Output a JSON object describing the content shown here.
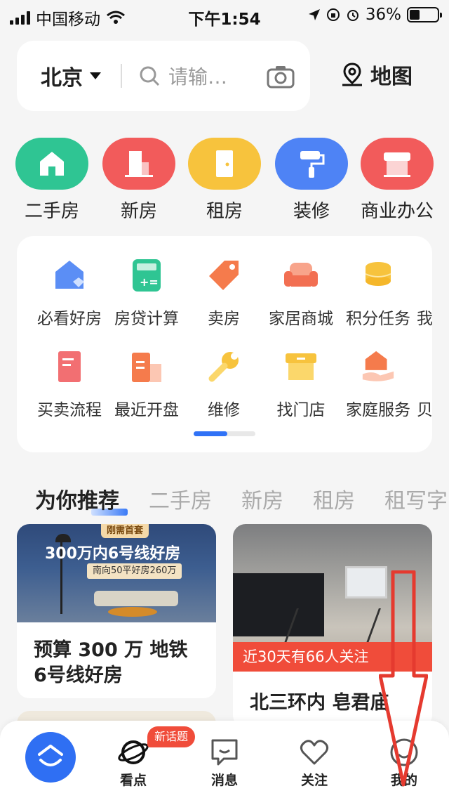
{
  "status_bar": {
    "carrier": "中国移动",
    "time": "下午1:54",
    "battery": "36%",
    "battery_level": 0.36
  },
  "header": {
    "city": "北京",
    "search_placeholder": "请输…",
    "map_label": "地图"
  },
  "categories": [
    {
      "label": "二手房",
      "color": "#2fc593",
      "icon": "house-icon"
    },
    {
      "label": "新房",
      "color": "#f25b5b",
      "icon": "building-icon"
    },
    {
      "label": "租房",
      "color": "#f7c33d",
      "icon": "door-icon"
    },
    {
      "label": "装修",
      "color": "#4e83f5",
      "icon": "paint-roller-icon"
    },
    {
      "label": "商业办公",
      "color": "#f25b5b",
      "icon": "storefront-icon"
    }
  ],
  "services": [
    {
      "label": "必看好房",
      "icon": "house-badge-icon"
    },
    {
      "label": "房贷计算",
      "icon": "calculator-icon"
    },
    {
      "label": "卖房",
      "icon": "price-tag-icon"
    },
    {
      "label": "家居商城",
      "icon": "sofa-icon"
    },
    {
      "label": "积分任务",
      "icon": "coins-icon"
    },
    {
      "label": "我",
      "icon": "partial-icon"
    },
    {
      "label": "买卖流程",
      "icon": "book-icon"
    },
    {
      "label": "最近开盘",
      "icon": "building-list-icon"
    },
    {
      "label": "维修",
      "icon": "wrench-icon"
    },
    {
      "label": "找门店",
      "icon": "box-icon"
    },
    {
      "label": "家庭服务",
      "icon": "hand-house-icon"
    },
    {
      "label": "贝",
      "icon": "partial-icon"
    }
  ],
  "feed_tabs": [
    "为你推荐",
    "二手房",
    "新房",
    "租房",
    "租写字"
  ],
  "cards": [
    {
      "tag": "刚需首套",
      "headline": "300万内6号线好房",
      "subline": "南向50平好房260万",
      "title_line1": "预算 300 万 地铁",
      "title_line2": "6号线好房"
    },
    {
      "banner": "近30天有66人关注",
      "title": "北三环内 皂君庙"
    }
  ],
  "bottom_nav": {
    "items": [
      {
        "label": "看点",
        "icon": "planet-icon"
      },
      {
        "label": "消息",
        "icon": "message-icon"
      },
      {
        "label": "关注",
        "icon": "heart-icon"
      },
      {
        "label": "我的",
        "icon": "profile-icon"
      }
    ],
    "badge": "新话题"
  },
  "colors": {
    "accent": "#2f6ff3",
    "red": "#f04c3a"
  }
}
